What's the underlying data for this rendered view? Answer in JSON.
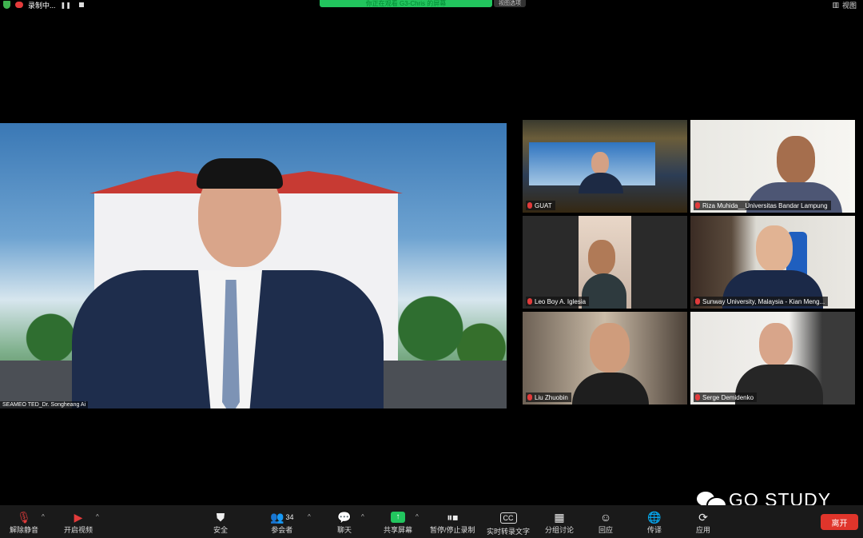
{
  "top_bar": {
    "recording_label": "录制中...",
    "sharing_banner": "你正在观看 G3-Chris 的屏幕",
    "view_options": "视图选项",
    "view_button": "视图"
  },
  "main_video": {
    "name_tag": "SEAMEO TED_Dr. Songheang Ai"
  },
  "participants": [
    {
      "name": "GUAT",
      "active": true
    },
    {
      "name": "Riza Muhida__Universitas Bandar Lampung"
    },
    {
      "name": "Leo Boy A. Iglesia"
    },
    {
      "name": "Sunway University, Malaysia - Kian Meng..."
    },
    {
      "name": "Liu Zhuobin"
    },
    {
      "name": "Serge Demidenko"
    }
  ],
  "watermark": "GO STUDY",
  "toolbar": {
    "unmute": "解除静音",
    "start_video": "开启视频",
    "security": "安全",
    "participants_label": "参会者",
    "participants_count": "34",
    "chat": "聊天",
    "share_screen": "共享屏幕",
    "pause_record": "暂停/停止录制",
    "live_transcript": "实时转录文字",
    "breakout": "分组讨论",
    "reactions": "回应",
    "interpretation": "传译",
    "apps": "应用",
    "leave": "离开"
  },
  "colors": {
    "active_border": "#37c44b",
    "leave_button": "#e0352b",
    "muted_mic": "#e23b3b",
    "share_green": "#22c55e"
  }
}
